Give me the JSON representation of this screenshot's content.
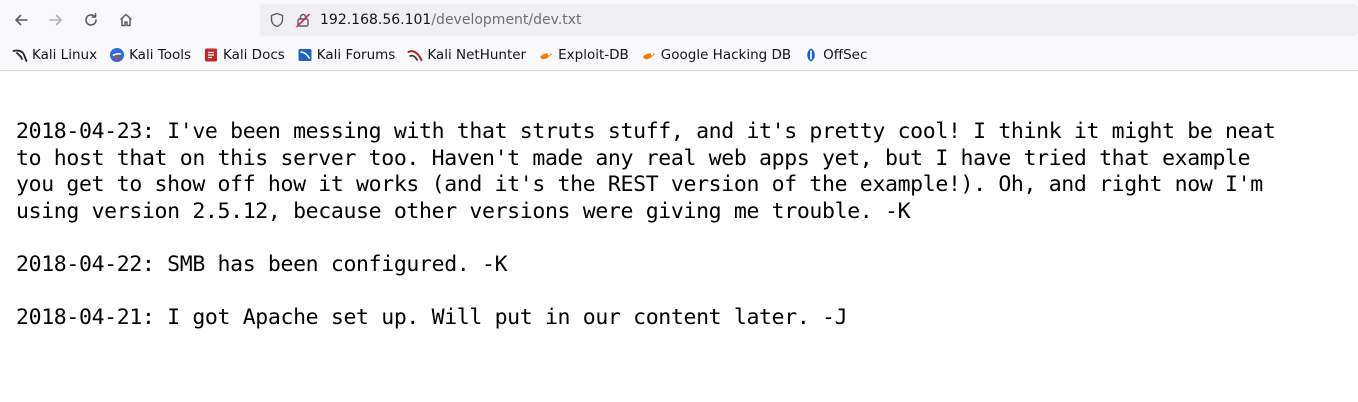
{
  "browser": {
    "url_host": "192.168.56.101",
    "url_path": "/development/dev.txt",
    "nav_icons": [
      "back-arrow-icon",
      "forward-arrow-icon",
      "reload-icon",
      "home-icon"
    ]
  },
  "bookmarks": [
    {
      "label": "Kali Linux",
      "icon": "kali-dragon-icon"
    },
    {
      "label": "Kali Tools",
      "icon": "kali-tools-icon"
    },
    {
      "label": "Kali Docs",
      "icon": "kali-docs-icon"
    },
    {
      "label": "Kali Forums",
      "icon": "kali-forums-icon"
    },
    {
      "label": "Kali NetHunter",
      "icon": "kali-nethunter-icon"
    },
    {
      "label": "Exploit-DB",
      "icon": "exploit-db-icon"
    },
    {
      "label": "Google Hacking DB",
      "icon": "google-hacking-db-icon"
    },
    {
      "label": "OffSec",
      "icon": "offsec-icon"
    }
  ],
  "document": {
    "lines": [
      "2018-04-23: I've been messing with that struts stuff, and it's pretty cool! I think it might be neat",
      "to host that on this server too. Haven't made any real web apps yet, but I have tried that example",
      "you get to show off how it works (and it's the REST version of the example!). Oh, and right now I'm",
      "using version 2.5.12, because other versions were giving me trouble. -K",
      "",
      "2018-04-22: SMB has been configured. -K",
      "",
      "2018-04-21: I got Apache set up. Will put in our content later. -J"
    ]
  },
  "colors": {
    "toolbar_bg": "#f9f9fb",
    "urlbar_bg": "#f0f0f4",
    "text": "#15141a",
    "muted": "#6d6d75",
    "icon": "#5b5b66",
    "disabled_icon": "#b1b1b3"
  }
}
